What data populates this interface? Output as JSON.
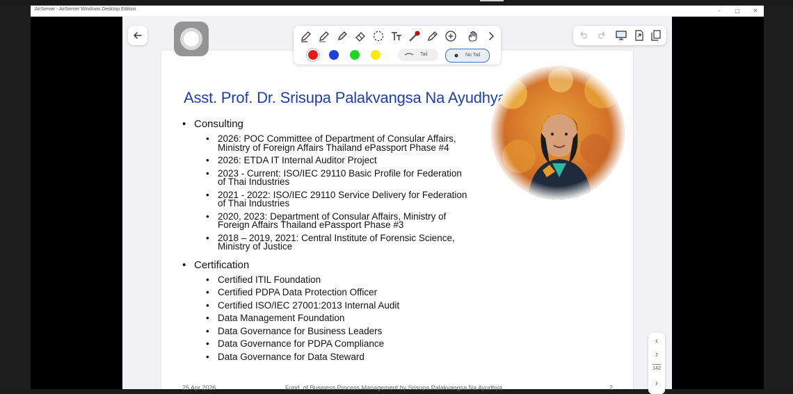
{
  "window": {
    "title": "AirServer - AirServer Windows Desktop Edition",
    "minimize": "–",
    "maximize": "▢",
    "close": "✕"
  },
  "toolbar": {
    "colors": [
      "#e41b1b",
      "#1f3fe0",
      "#22d12a",
      "#f4ea17"
    ],
    "tail_label": "Tail",
    "no_tail_label": "No Tail",
    "more_icon": "chevron-right-icon"
  },
  "slide": {
    "heading": "Asst. Prof. Dr. Srisupa Palakvangsa Na Ayudhya",
    "sections": [
      {
        "label": "Consulting",
        "items": [
          [
            "2026: POC Committee of Department of Consular Affairs,",
            "Ministry of Foreign Affairs Thailand ePassport Phase #4"
          ],
          [
            "2026: ETDA IT Internal Auditor Project"
          ],
          [
            "2023 - Current: ISO/IEC 29110 Basic Profile for Federation",
            "of Thai Industries"
          ],
          [
            "2021 - 2022: ISO/IEC 29110 Service Delivery for Federation",
            "of Thai Industries"
          ],
          [
            "2020, 2023: Department of Consular Affairs, Ministry of",
            "Foreign Affairs Thailand ePassport Phase #3"
          ],
          [
            "2018 – 2019, 2021: Central Institute of Forensic Science,",
            "Ministry of Justice"
          ]
        ]
      },
      {
        "label": "Certification",
        "items": [
          [
            "Certified ITIL Foundation"
          ],
          [
            "Certified PDPA Data Protection Officer"
          ],
          [
            "Certified ISO/IEC 27001:2013 Internal Audit"
          ],
          [
            "Data Management Foundation"
          ],
          [
            "Data Governance for Business Leaders"
          ],
          [
            "Data Governance for PDPA Compliance"
          ],
          [
            "Data Governance for Data Steward"
          ]
        ]
      }
    ],
    "footer_date": "25 Apr 2026",
    "footer_title": "Fund. of Business Process Management by Srisupa Palakvangsa Na Ayudhya",
    "footer_page": "2"
  },
  "pager": {
    "current": "2",
    "total": "142",
    "prev": "‹",
    "next": "›"
  }
}
